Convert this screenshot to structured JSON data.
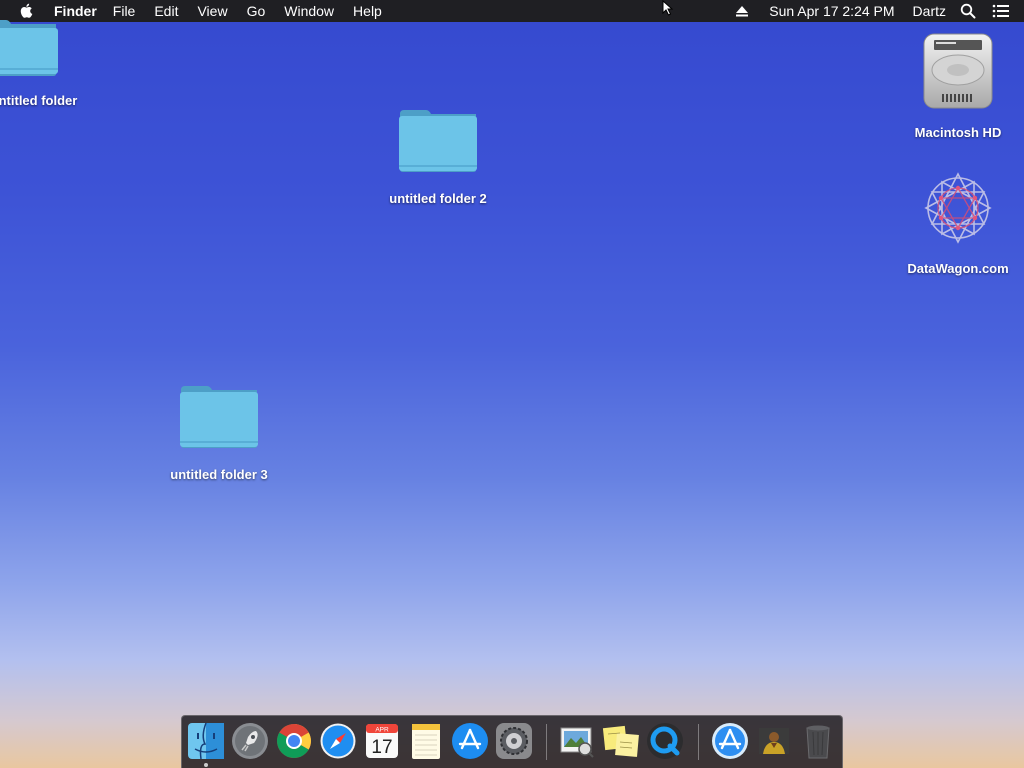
{
  "menubar": {
    "app_name": "Finder",
    "menus": [
      "File",
      "Edit",
      "View",
      "Go",
      "Window",
      "Help"
    ],
    "clock": "Sun Apr 17  2:24 PM",
    "user": "Dartz",
    "icons": [
      "apple-icon",
      "eject-icon",
      "spotlight-search-icon",
      "notification-center-icon"
    ]
  },
  "desktop": {
    "items": [
      {
        "label": "untitled folder",
        "icon": "folder-icon"
      },
      {
        "label": "untitled folder 2",
        "icon": "folder-icon"
      },
      {
        "label": "untitled folder 3",
        "icon": "folder-icon"
      },
      {
        "label": "Macintosh HD",
        "icon": "hard-drive-icon"
      },
      {
        "label": "DataWagon.com",
        "icon": "network-volume-icon"
      }
    ]
  },
  "dock": {
    "apps": [
      {
        "name": "Finder",
        "icon": "finder-icon",
        "running": true
      },
      {
        "name": "Launchpad",
        "icon": "launchpad-icon"
      },
      {
        "name": "Google Chrome",
        "icon": "chrome-icon"
      },
      {
        "name": "Safari",
        "icon": "safari-icon"
      },
      {
        "name": "Calendar",
        "icon": "calendar-icon",
        "month": "APR",
        "day": "17"
      },
      {
        "name": "Notes",
        "icon": "notes-icon"
      },
      {
        "name": "App Store",
        "icon": "app-store-icon"
      },
      {
        "name": "System Preferences",
        "icon": "system-preferences-icon"
      },
      {
        "name": "Preview",
        "icon": "preview-icon"
      },
      {
        "name": "Stickies",
        "icon": "stickies-icon"
      },
      {
        "name": "QuickTime Player",
        "icon": "quicktime-icon"
      },
      {
        "name": "Applications",
        "icon": "applications-folder-icon"
      },
      {
        "name": "Downloads",
        "icon": "downloads-stack-icon"
      },
      {
        "name": "Trash",
        "icon": "trash-icon"
      }
    ]
  },
  "colors": {
    "menubar": "#1f1f23",
    "folder": "#6cc4e8",
    "desktop_top": "#3549cf",
    "desktop_bottom": "#e9c79f"
  }
}
